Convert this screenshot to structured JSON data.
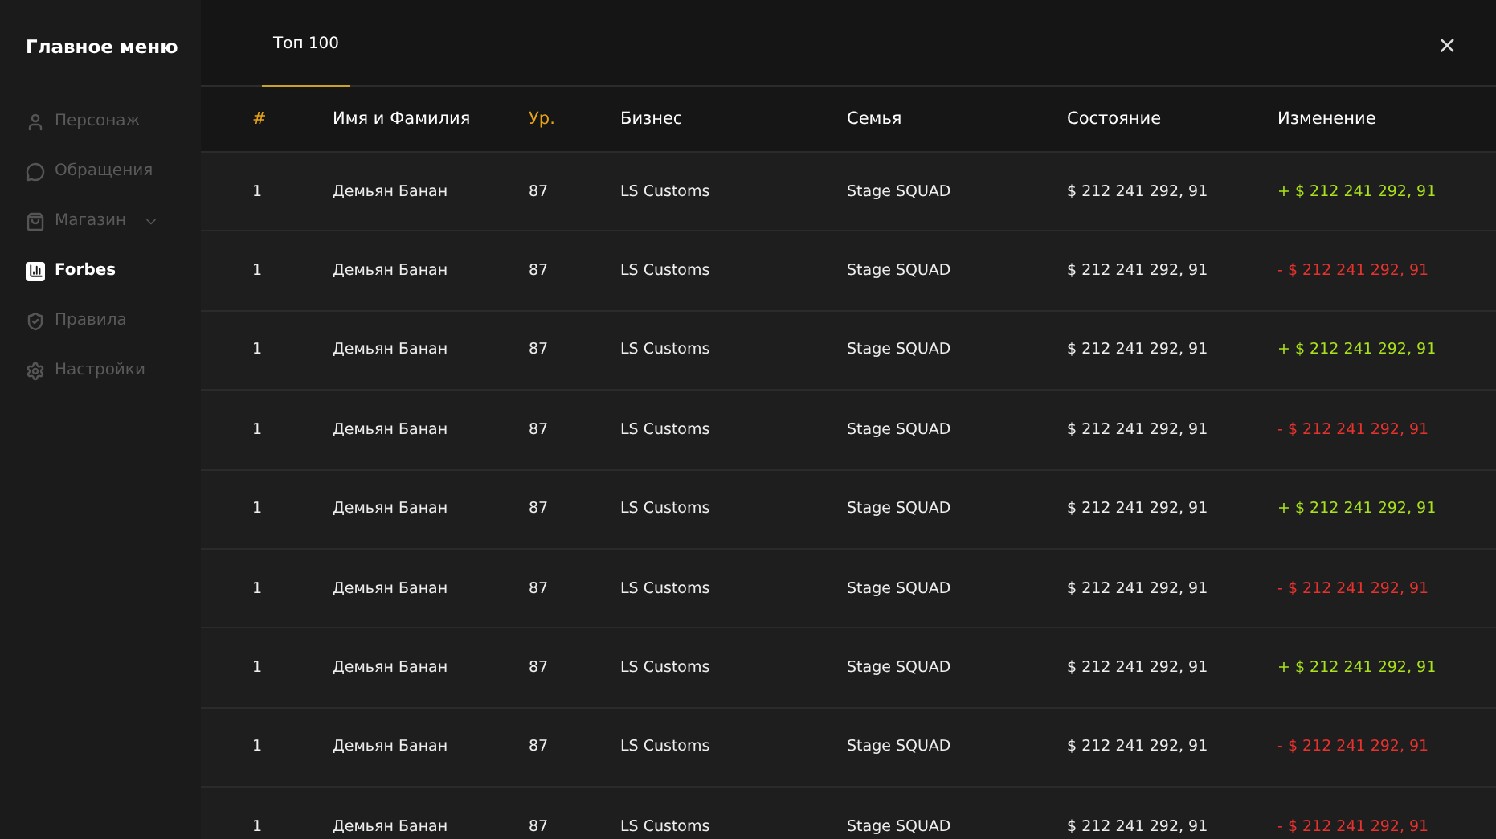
{
  "sidebar": {
    "title": "Главное меню",
    "items": [
      {
        "label": "Персонаж",
        "selected": false,
        "expandable": false
      },
      {
        "label": "Обращения",
        "selected": false,
        "expandable": false
      },
      {
        "label": "Магазин",
        "selected": false,
        "expandable": true
      },
      {
        "label": "Forbes",
        "selected": true,
        "expandable": false
      },
      {
        "label": "Правила",
        "selected": false,
        "expandable": false
      },
      {
        "label": "Настройки",
        "selected": false,
        "expandable": false
      }
    ]
  },
  "tabs": [
    {
      "label": "Топ 100",
      "selected": true
    }
  ],
  "close": "×",
  "table": {
    "columns": [
      {
        "label": "#",
        "accent": true
      },
      {
        "label": "Имя и Фамилия",
        "accent": false
      },
      {
        "label": "Ур.",
        "accent": true
      },
      {
        "label": "Бизнес",
        "accent": false
      },
      {
        "label": "Семья",
        "accent": false
      },
      {
        "label": "Состояние",
        "accent": false
      },
      {
        "label": "Изменение",
        "accent": false
      }
    ],
    "rows": [
      {
        "rank": "1",
        "name": "Демьян Банан",
        "level": "87",
        "business": "LS Customs",
        "family": "Stage SQUAD",
        "wealth": "$ 212 241 292, 91",
        "change": "+ $ 212 241 292, 91",
        "kind": "gain"
      },
      {
        "rank": "1",
        "name": "Демьян Банан",
        "level": "87",
        "business": "LS Customs",
        "family": "Stage SQUAD",
        "wealth": "$ 212 241 292, 91",
        "change": "- $ 212 241 292, 91",
        "kind": "loss"
      },
      {
        "rank": "1",
        "name": "Демьян Банан",
        "level": "87",
        "business": "LS Customs",
        "family": "Stage SQUAD",
        "wealth": "$ 212 241 292, 91",
        "change": "+ $ 212 241 292, 91",
        "kind": "gain"
      },
      {
        "rank": "1",
        "name": "Демьян Банан",
        "level": "87",
        "business": "LS Customs",
        "family": "Stage SQUAD",
        "wealth": "$ 212 241 292, 91",
        "change": "- $ 212 241 292, 91",
        "kind": "loss"
      },
      {
        "rank": "1",
        "name": "Демьян Банан",
        "level": "87",
        "business": "LS Customs",
        "family": "Stage SQUAD",
        "wealth": "$ 212 241 292, 91",
        "change": "+ $ 212 241 292, 91",
        "kind": "gain"
      },
      {
        "rank": "1",
        "name": "Демьян Банан",
        "level": "87",
        "business": "LS Customs",
        "family": "Stage SQUAD",
        "wealth": "$ 212 241 292, 91",
        "change": "- $ 212 241 292, 91",
        "kind": "loss"
      },
      {
        "rank": "1",
        "name": "Демьян Банан",
        "level": "87",
        "business": "LS Customs",
        "family": "Stage SQUAD",
        "wealth": "$ 212 241 292, 91",
        "change": "+ $ 212 241 292, 91",
        "kind": "gain"
      },
      {
        "rank": "1",
        "name": "Демьян Банан",
        "level": "87",
        "business": "LS Customs",
        "family": "Stage SQUAD",
        "wealth": "$ 212 241 292, 91",
        "change": "- $ 212 241 292, 91",
        "kind": "loss"
      },
      {
        "rank": "1",
        "name": "Демьян Банан",
        "level": "87",
        "business": "LS Customs",
        "family": "Stage SQUAD",
        "wealth": "$ 212 241 292, 91",
        "change": "- $ 212 241 292, 91",
        "kind": "loss"
      }
    ]
  }
}
